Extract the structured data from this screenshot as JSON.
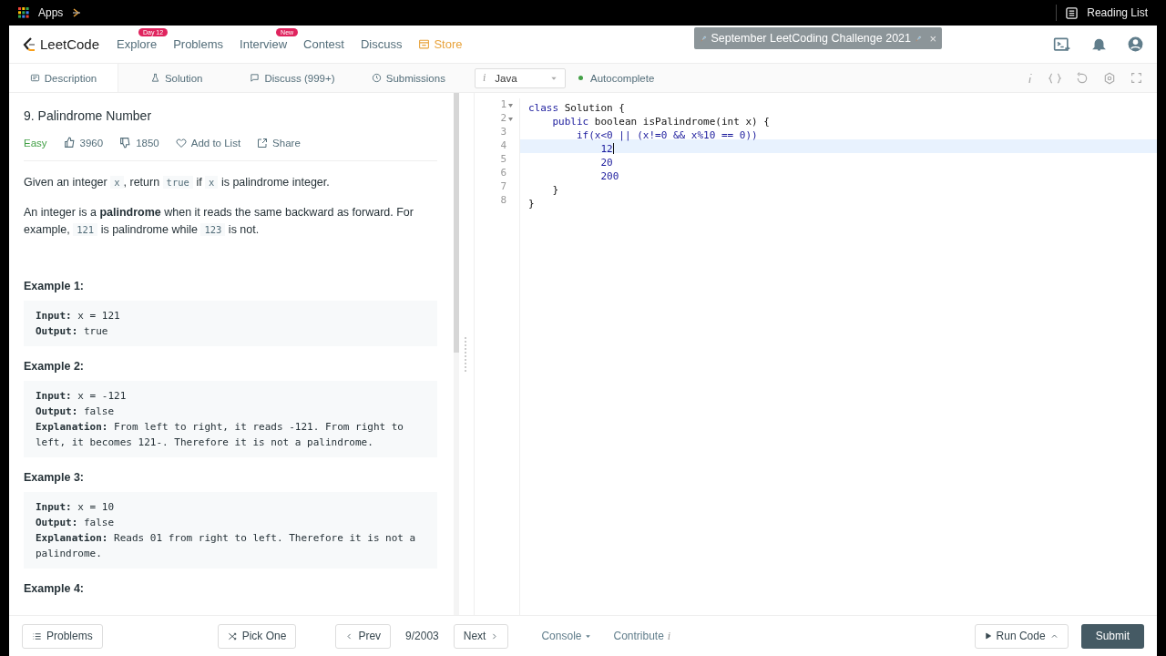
{
  "browser_bar": {
    "apps_label": "Apps",
    "reading_list": "Reading List"
  },
  "navbar": {
    "logo_text": "LeetCode",
    "items": [
      {
        "label": "Explore",
        "badge": "Day 12",
        "kind": "link"
      },
      {
        "label": "Problems",
        "kind": "link"
      },
      {
        "label": "Interview",
        "badge": "New",
        "kind": "link"
      },
      {
        "label": "Contest",
        "kind": "link"
      },
      {
        "label": "Discuss",
        "kind": "link"
      },
      {
        "label": "Store",
        "kind": "store"
      }
    ],
    "banner": {
      "text": "September LeetCoding Challenge 2021",
      "close": "×"
    }
  },
  "tabs": [
    {
      "label": "Description",
      "selected": true
    },
    {
      "label": "Solution",
      "selected": false
    },
    {
      "label": "Discuss (999+)",
      "selected": false
    },
    {
      "label": "Submissions",
      "selected": false
    }
  ],
  "editor_toolbar": {
    "language": "Java",
    "language_hint": "i",
    "autocomplete": {
      "label": "Autocomplete",
      "on": true
    }
  },
  "problem": {
    "title": "9. Palindrome Number",
    "difficulty": "Easy",
    "likes": "3960",
    "dislikes": "1850",
    "add_to_list": "Add to List",
    "share": "Share",
    "paragraphs": [
      [
        {
          "kind": "text",
          "text": "Given an integer "
        },
        {
          "kind": "code",
          "text": "x"
        },
        {
          "kind": "text",
          "text": ", return "
        },
        {
          "kind": "code",
          "text": "true"
        },
        {
          "kind": "text",
          "text": " if "
        },
        {
          "kind": "code",
          "text": "x"
        },
        {
          "kind": "text",
          "text": " is palindrome integer."
        }
      ],
      [
        {
          "kind": "text",
          "text": "An integer is a **palindrome** when it reads the same backward as forward. For example, "
        },
        {
          "kind": "code",
          "text": "121"
        },
        {
          "kind": "text",
          "text": " is palindrome while "
        },
        {
          "kind": "code",
          "text": "123"
        },
        {
          "kind": "text",
          "text": " is not."
        }
      ]
    ],
    "examples": [
      {
        "heading": "Example 1:",
        "lines": [
          "**Input:** x = 121",
          "**Output:** true"
        ]
      },
      {
        "heading": "Example 2:",
        "lines": [
          "**Input:** x = -121",
          "**Output:** false",
          "**Explanation:** From left to right, it reads -121. From right to left, it becomes 121-. Therefore it is not a palindrome."
        ]
      },
      {
        "heading": "Example 3:",
        "lines": [
          "**Input:** x = 10",
          "**Output:** false",
          "**Explanation:** Reads 01 from right to left. Therefore it is not a palindrome."
        ]
      },
      {
        "heading": "Example 4:"
      }
    ]
  },
  "code_lines": [
    {
      "number": "1",
      "fold": true,
      "active": false,
      "tokens": [
        {
          "kind": "keyword",
          "text": "class"
        },
        {
          "kind": "plain",
          "text": " Solution {"
        }
      ]
    },
    {
      "number": "2",
      "fold": true,
      "active": false,
      "tokens": [
        {
          "kind": "keyword",
          "text": "    public"
        },
        {
          "kind": "plain",
          "text": " boolean isPalindrome(int x) {"
        }
      ]
    },
    {
      "number": "3",
      "fold": false,
      "active": false,
      "tokens": [
        {
          "kind": "keyword",
          "text": "        if(x<0 || (x!=0 && x%10 == 0))"
        }
      ]
    },
    {
      "number": "4",
      "fold": false,
      "active": true,
      "tokens": [
        {
          "kind": "number",
          "text": "            12"
        }
      ]
    },
    {
      "number": "5",
      "fold": false,
      "active": false,
      "tokens": [
        {
          "kind": "number",
          "text": "            20"
        }
      ]
    },
    {
      "number": "6",
      "fold": false,
      "active": false,
      "tokens": [
        {
          "kind": "number",
          "text": "            200"
        }
      ]
    },
    {
      "number": "7",
      "fold": false,
      "active": false,
      "tokens": [
        {
          "kind": "plain",
          "text": "    }"
        }
      ]
    },
    {
      "number": "8",
      "fold": false,
      "active": false,
      "tokens": [
        {
          "kind": "plain",
          "text": "}"
        }
      ]
    }
  ],
  "footer": {
    "problems": "Problems",
    "pick_one": "Pick One",
    "prev": "Prev",
    "position": "9/2003",
    "next": "Next",
    "console": "Console",
    "contribute": "Contribute",
    "contribute_hint": "i",
    "run_code": "Run Code",
    "submit": "Submit"
  }
}
